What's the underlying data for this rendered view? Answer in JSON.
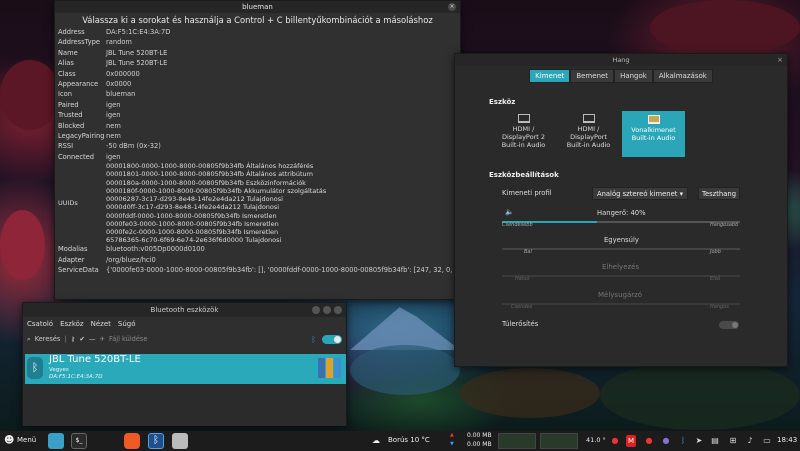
{
  "blueman": {
    "title": "blueman",
    "hint": "Válassza ki a sorokat és használja a Control + C billentyűkombinációt a másoláshoz",
    "rows": [
      {
        "key": "Address",
        "value": "DA:F5:1C:E4:3A:7D"
      },
      {
        "key": "AddressType",
        "value": "random"
      },
      {
        "key": "Name",
        "value": "JBL Tune 520BT-LE"
      },
      {
        "key": "Alias",
        "value": "JBL Tune 520BT-LE"
      },
      {
        "key": "Class",
        "value": "0x000000"
      },
      {
        "key": "Appearance",
        "value": "0x0000"
      },
      {
        "key": "Icon",
        "value": "blueman"
      },
      {
        "key": "Paired",
        "value": "igen"
      },
      {
        "key": "Trusted",
        "value": "igen"
      },
      {
        "key": "Blocked",
        "value": "nem"
      },
      {
        "key": "LegacyPairing",
        "value": "nem"
      },
      {
        "key": "RSSI",
        "value": "-50 dBm (0x-32)"
      },
      {
        "key": "Connected",
        "value": "igen"
      }
    ],
    "uuids_label": "UUIDs",
    "uuids": [
      "00001800-0000-1000-8000-00805f9b34fb Általános hozzáférés",
      "00001801-0000-1000-8000-00805f9b34fb Általános attribútum",
      "0000180a-0000-1000-8000-00805f9b34fb Eszközinformációk",
      "0000180f-0000-1000-8000-00805f9b34fb Akkumulátor szolgáltatás",
      "00006287-3c17-d293-8e48-14fe2e4da212 Tulajdonosi",
      "0000d0ff-3c17-d293-8e48-14fe2e4da212 Tulajdonosi",
      "0000fddf-0000-1000-8000-00805f9b34fb Ismeretlen",
      "0000fe03-0000-1000-8000-00805f9b34fb Ismeretlen",
      "0000fe2c-0000-1000-8000-00805f9b34fb Ismeretlen",
      "65786365-6c70-6f69-6e74-2e636f6d0000 Tulajdonosi"
    ],
    "rows_after": [
      {
        "key": "Modalias",
        "value": "bluetooth:v005Dp0000d0100"
      },
      {
        "key": "Adapter",
        "value": "/org/bluez/hci0"
      },
      {
        "key": "ServiceData",
        "value": "{'0000fe03-0000-1000-8000-00805f9b34fb': [], '0000fddf-0000-1000-8000-00805f9b34fb': [247, 32, 0, 0, 0]}"
      }
    ]
  },
  "btwin": {
    "title": "Bluetooth eszközök",
    "menu": [
      "Csatoló",
      "Eszköz",
      "Nézet",
      "Súgó"
    ],
    "search_label": "Keresés",
    "send_label": "Fájl küldése",
    "device": {
      "name": "JBL Tune 520BT-LE",
      "type": "Vegyes",
      "address": "DA:F5:1C:E4:3A:7D"
    }
  },
  "hang": {
    "title": "Hang",
    "tabs": [
      "Kimenet",
      "Bemenet",
      "Hangok",
      "Alkalmazások"
    ],
    "device_section": "Eszköz",
    "devices": [
      {
        "label1": "HDMI /",
        "label2": "DisplayPort 2",
        "label3": "Built-in Audio"
      },
      {
        "label1": "HDMI /",
        "label2": "DisplayPort",
        "label3": "Built-in Audio"
      },
      {
        "label1": "Vonalkimenet",
        "label2": "Built-in Audio",
        "label3": ""
      }
    ],
    "settings_section": "Eszközbeállítások",
    "profile_label": "Kimeneti profil",
    "profile_value": "Analóg sztereó kimenet",
    "test_label": "Teszthang",
    "volume_label": "Hangerő: 40%",
    "volume_percent": 40,
    "quiet": "Csendesebb",
    "loud": "Hangosabb",
    "balance_label": "Egyensúly",
    "left": "Bal",
    "right": "Jobb",
    "fade_label": "Elhelyezés",
    "rear": "Hátsó",
    "front": "Első",
    "bass_label": "Mélysugárzó",
    "soft": "Csendes",
    "loud2": "Hangos",
    "overamp_label": "Túlerősítés"
  },
  "taskbar": {
    "menu_label": "Menü",
    "weather": "Borús 10 °C",
    "net_up": "0.00 MB",
    "net_down": "0.00 MB",
    "temp": "41.0 °",
    "clock": "18:43"
  },
  "colors": {
    "accent": "#2aa6b8",
    "panel": "#1c1c1c"
  }
}
